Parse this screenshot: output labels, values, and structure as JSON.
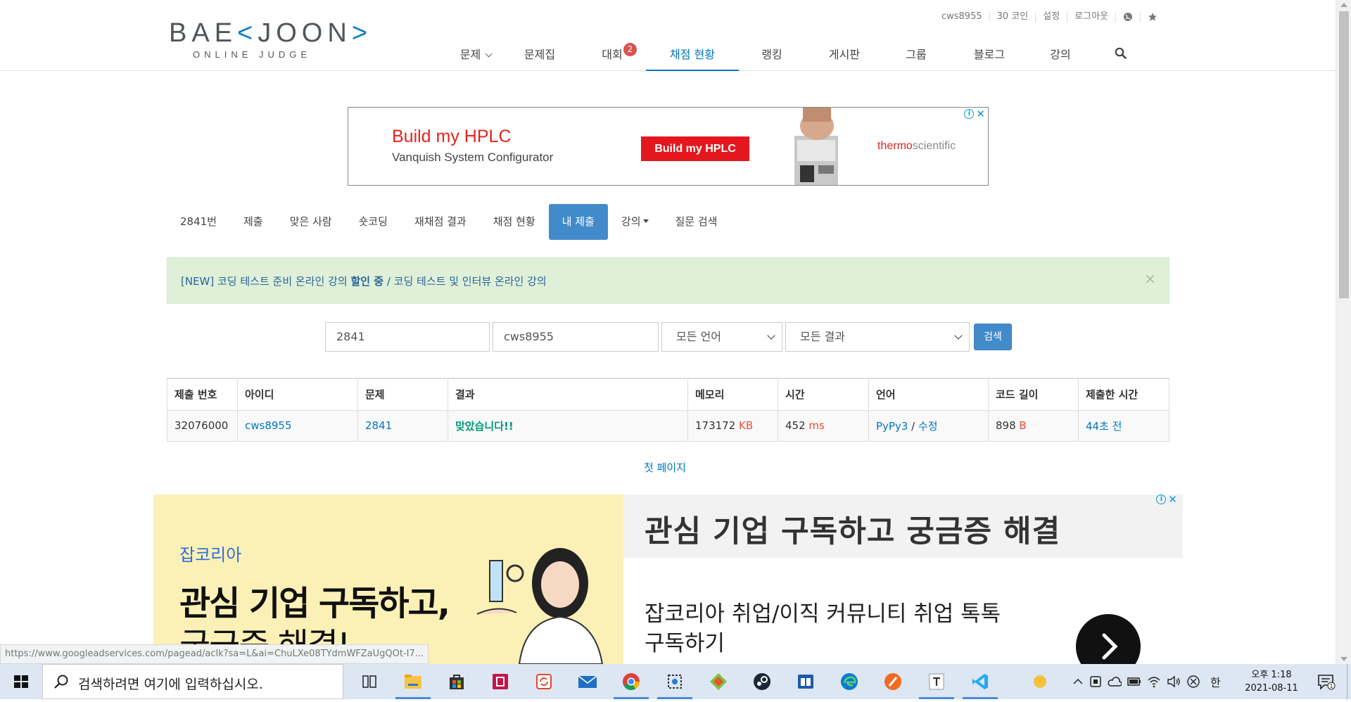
{
  "header": {
    "logo_main": "BAE<JOON>",
    "logo_sub": "ONLINE JUDGE",
    "top_links": [
      "cws8955",
      "30 코인",
      "설정",
      "로그아웃"
    ],
    "nav": [
      {
        "label": "문제"
      },
      {
        "label": "문제집"
      },
      {
        "label": "대회",
        "badge": "2"
      },
      {
        "label": "채점 현황"
      },
      {
        "label": "랭킹"
      },
      {
        "label": "게시판"
      },
      {
        "label": "그룹"
      },
      {
        "label": "블로그"
      },
      {
        "label": "강의"
      }
    ]
  },
  "ad_top": {
    "title": "Build my HPLC",
    "subtitle": "Vanquish System Configurator",
    "button": "Build my HPLC",
    "brand_a": "thermo",
    "brand_b": "scientific"
  },
  "problem_tabs": [
    "2841번",
    "제출",
    "맞은 사람",
    "숏코딩",
    "재채점 결과",
    "채점 현황",
    "내 제출",
    "강의",
    "질문 검색"
  ],
  "notice": {
    "part1": "[NEW] 코딩 테스트 준비 온라인 강의 ",
    "part2": "할인 중",
    "part3": " / 코딩 테스트 및 인터뷰 온라인 강의"
  },
  "search": {
    "problem_value": "2841",
    "user_value": "cws8955",
    "language": "모든 언어",
    "result": "모든 결과",
    "button": "검색"
  },
  "table": {
    "headers": [
      "제출 번호",
      "아이디",
      "문제",
      "결과",
      "메모리",
      "시간",
      "언어",
      "코드 길이",
      "제출한 시간"
    ],
    "row": {
      "id": "32076000",
      "user": "cws8955",
      "problem": "2841",
      "result": "맞았습니다!!",
      "memory": "173172",
      "memory_unit": "KB",
      "time": "452",
      "time_unit": "ms",
      "language": "PyPy3",
      "edit": "수정",
      "code_length": "898",
      "code_unit": "B",
      "submitted": "44초 전"
    }
  },
  "first_page": "첫 페이지",
  "ad_bottom": {
    "brand": "잡코리아",
    "line1": "관심 기업 구독하고,",
    "line2": "궁금증 해결!",
    "headline": "관심 기업 구독하고 궁금증 해결",
    "desc": "잡코리아 취업/이직 커뮤니티 취업 톡톡 구독하기"
  },
  "status_url": "https://www.googleadservices.com/pagead/aclk?sa=L&ai=ChuLXe08TYdmWFZaUgQOt-I7...",
  "taskbar": {
    "search_placeholder": "검색하려면 여기에 입력하십시오.",
    "ime": "한",
    "time": "오후 1:18",
    "date": "2021-08-11",
    "notif_count": "1"
  }
}
